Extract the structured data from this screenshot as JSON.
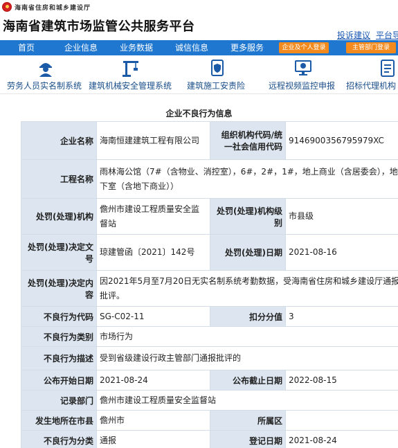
{
  "header": {
    "dept_name": "海南省住房和城乡建设厅",
    "site_title": "海南省建筑市场监管公共服务平台",
    "link_feedback": "投诉建议",
    "link_platform": "平台导"
  },
  "nav": {
    "items": [
      "首页",
      "企业信息",
      "业务数据",
      "诚信信息",
      "更多服务"
    ],
    "login_enterprise": "企业及个人登录",
    "login_admin": "主管部门登录"
  },
  "quick_links": [
    {
      "label": "劳务人员实名制系统",
      "icon": "worker-icon"
    },
    {
      "label": "建筑机械安全管理系统",
      "icon": "crane-icon"
    },
    {
      "label": "建筑施工安责险",
      "icon": "insurance-icon"
    },
    {
      "label": "远程视频监控申报",
      "icon": "monitor-icon"
    },
    {
      "label": "招标代理机构",
      "icon": "document-icon"
    }
  ],
  "section_title": "企业不良行为信息",
  "record": {
    "company_name_label": "企业名称",
    "company_name": "海南恒建建筑工程有限公司",
    "org_code_label": "组织机构代码/统一社会信用代码",
    "org_code": "9146900356795979XC",
    "project_label": "工程名称",
    "project": "雨林海公馆（7#（含物业、消控室），6#，2#，1#，地上商业（含居委会），地下室（含地下商业））",
    "authority_label": "处罚(处理)机构",
    "authority": "儋州市建设工程质量安全监督站",
    "authority_level_label": "处罚(处理)机构级别",
    "authority_level": "市县级",
    "decision_no_label": "处罚(处理)决定文号",
    "decision_no": "琼建管函〔2021〕142号",
    "decision_date_label": "处罚(处理)日期",
    "decision_date": "2021-08-16",
    "decision_content_label": "处罚(处理)决定内容",
    "decision_content": "因2021年5月至7月20日无实名制系统考勤数据，受海南省住房和城乡建设厅通报批评。",
    "behavior_code_label": "不良行为代码",
    "behavior_code": "SG-C02-11",
    "points_label": "扣分分值",
    "points": "3",
    "behavior_category_label": "不良行为类别",
    "behavior_category": "市场行为",
    "behavior_desc_label": "不良行为描述",
    "behavior_desc": "受到省级建设行政主管部门通报批评的",
    "publish_start_label": "公布开始日期",
    "publish_start": "2021-08-24",
    "publish_end_label": "公布截止日期",
    "publish_end": "2022-08-15",
    "record_dept_label": "记录部门",
    "record_dept": "儋州市建设工程质量安全监督站",
    "city_label": "发生地所在市县",
    "city": "儋州市",
    "district_label": "所属区",
    "district": "",
    "classification_label": "不良行为分类",
    "classification": "通报",
    "register_date_label": "登记日期",
    "register_date": "2021-08-24"
  },
  "colors": {
    "nav_blue": "#1f77d0",
    "login_orange": "#f28a1e",
    "label_bg": "#dde6f0",
    "link_blue": "#1a57b3",
    "emblem_red": "#d21f1f"
  }
}
